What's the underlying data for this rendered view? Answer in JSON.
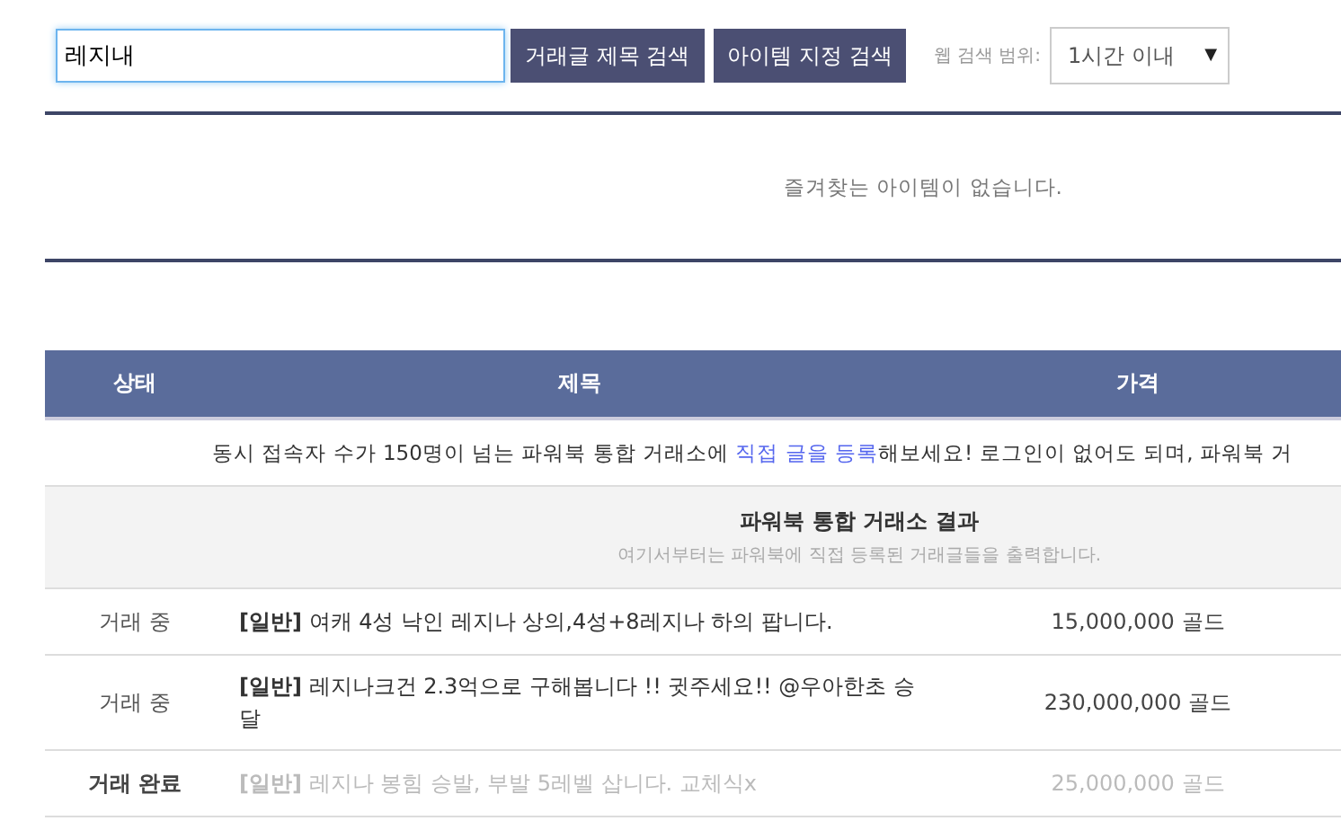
{
  "search": {
    "value": "레지내",
    "buttons": [
      "거래글 제목 검색",
      "아이템 지정 검색"
    ],
    "range_label": "웹 검색 범위:",
    "range_value": "1시간 이내",
    "range_caret": "▼"
  },
  "favorites": {
    "message": "즐겨찾는 아이템이 없습니다."
  },
  "table": {
    "columns": [
      "상태",
      "제목",
      "가격"
    ],
    "notice": {
      "before": "동시 접속자 수가 150명이 넘는 파워북 통합 거래소에 ",
      "link": "직접 글을 등록",
      "after": "해보세요! 로그인이 없어도 되며, 파워북 거"
    },
    "section": {
      "title": "파워북 통합 거래소 결과",
      "subtitle": "여기서부터는 파워북에 직접 등록된 거래글들을 출력합니다."
    },
    "rows": [
      {
        "status": "거래 중",
        "title": "**[일반]** 여캐 4성 낙인 레지나 상의,4성+8레지나 하의 팝니다.",
        "price": "15,000,000 골드",
        "completed": false
      },
      {
        "status": "거래 중",
        "title": "**[일반]** 레지나크건 2.3억으로 구해봅니다 !! 귓주세요!! @우아한초 승달",
        "price": "230,000,000 골드",
        "completed": false
      },
      {
        "status": "거래 완료",
        "title": "**[일반]** 레지나 봉힘 승발, 부발 5레벨 삽니다. 교체식x",
        "price": "25,000,000 골드",
        "completed": true
      }
    ]
  }
}
